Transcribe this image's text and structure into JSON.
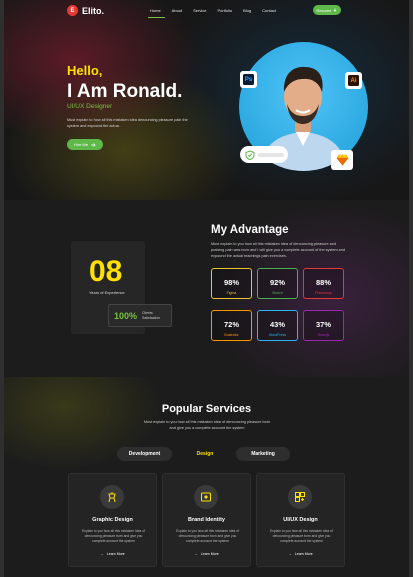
{
  "nav": {
    "logo_text": "Elito.",
    "logo_mark": "E",
    "items": [
      {
        "label": "Home",
        "active": true
      },
      {
        "label": "About",
        "active": false
      },
      {
        "label": "Service",
        "active": false
      },
      {
        "label": "Portfolio",
        "active": false
      },
      {
        "label": "Blog",
        "active": false
      },
      {
        "label": "Contact",
        "active": false
      }
    ],
    "resume_label": "Resume"
  },
  "hero": {
    "greeting": "Hello,",
    "name": "I Am Ronald.",
    "role": "UI/UX Designer",
    "description": "Must explain to how all this mistaken idea denouncing pleasure pain the system and expound the actua.",
    "cta_label": "Hire Me",
    "badges": {
      "ps": "Ps",
      "ai": "Ai"
    }
  },
  "advantage": {
    "years": "08",
    "years_label": "Years of Experience",
    "happy_pct": "100%",
    "happy_label": "Clients Satisfaction",
    "title": "My Advantage",
    "description": "Must explain to you how all this mistaken idea of denouncing pleasure and praising pain was born and I will give you a complete account of the system and expound the actual teachings pain exercises.",
    "stats": [
      {
        "value": "98%",
        "label": "Figma",
        "color": "#e8c630"
      },
      {
        "value": "92%",
        "label": "Sketch",
        "color": "#4caf50"
      },
      {
        "value": "88%",
        "label": "Photoshop",
        "color": "#e53935"
      },
      {
        "value": "72%",
        "label": "Illustrator",
        "color": "#ff9800"
      },
      {
        "value": "43%",
        "label": "WordPress",
        "color": "#29b6f6"
      },
      {
        "value": "37%",
        "label": "Reactjs",
        "color": "#9c27b0"
      }
    ]
  },
  "services": {
    "title": "Popular Services",
    "description": "Must explain to you how all this mistaken idea of denouncing pleasure born and give you a complete account the system",
    "tabs": [
      "Development",
      "Design",
      "Marketing"
    ],
    "cards": [
      {
        "title": "Graphic Design",
        "description": "Explain to you how all this mistaken idea of denouncing pleasure born and give you complete account the system",
        "link": "Learn More",
        "icon": "graphic-design-icon"
      },
      {
        "title": "Brand Identity",
        "description": "Explain to you how all this mistaken idea of denouncing pleasure born and give you complete account the system",
        "link": "Learn More",
        "icon": "brand-identity-icon"
      },
      {
        "title": "UI/UX Design",
        "description": "Explain to you how all this mistaken idea of denouncing pleasure born and give you complete account the system",
        "link": "Learn More",
        "icon": "layout-icon"
      }
    ]
  }
}
